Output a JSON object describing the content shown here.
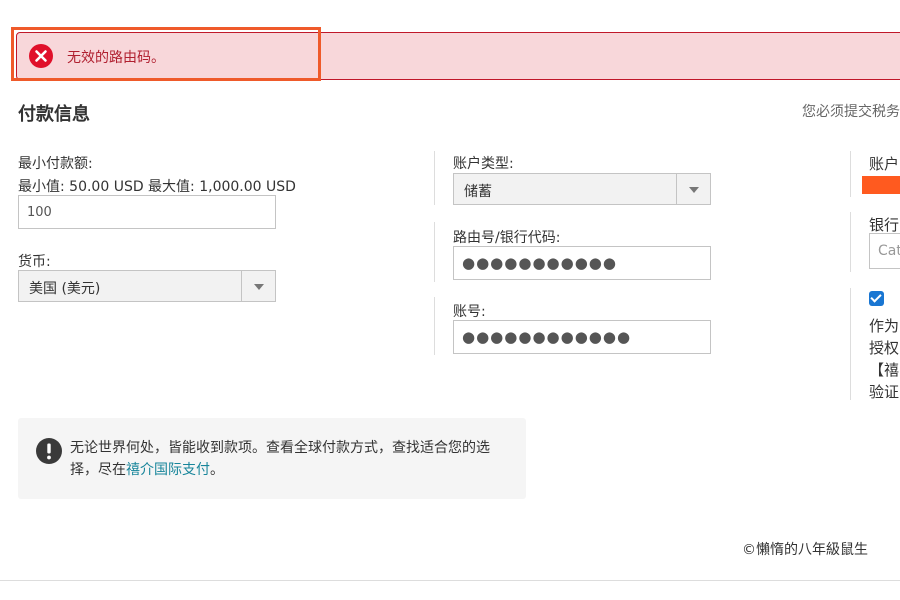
{
  "error": {
    "message": "无效的路由码。",
    "icon": "error-x-circle-icon",
    "color": "#c0182a"
  },
  "page": {
    "section_title": "付款信息",
    "tax_note": "您必须提交税务"
  },
  "min_payment": {
    "label": "最小付款额:",
    "range": "最小值: 50.00 USD 最大值: 1,000.00 USD",
    "value": "100"
  },
  "currency": {
    "label": "货币:",
    "selected": "美国 (美元)"
  },
  "account_type": {
    "label": "账户类型:",
    "selected": "储蓄"
  },
  "routing": {
    "label": "路由号/银行代码:",
    "masked_value": "●●●●●●●●●●●"
  },
  "account_number": {
    "label": "账号:",
    "masked_value": "●●●●●●●●●●●●"
  },
  "right_column": {
    "label1": "账户",
    "label2": "银行",
    "bank_input_text": "Cat",
    "lines": [
      "作为",
      "授权",
      "【禧",
      "验证"
    ],
    "accent_color": "#ff5a1f"
  },
  "info": {
    "text_before": "无论世界何处，皆能收到款项。查看全球付款方式，查找适合您的选择，尽在",
    "link_text": "禧介国际支付",
    "text_after": "。"
  },
  "footer": {
    "copyright": "©懶惰的八年級鼠生"
  }
}
